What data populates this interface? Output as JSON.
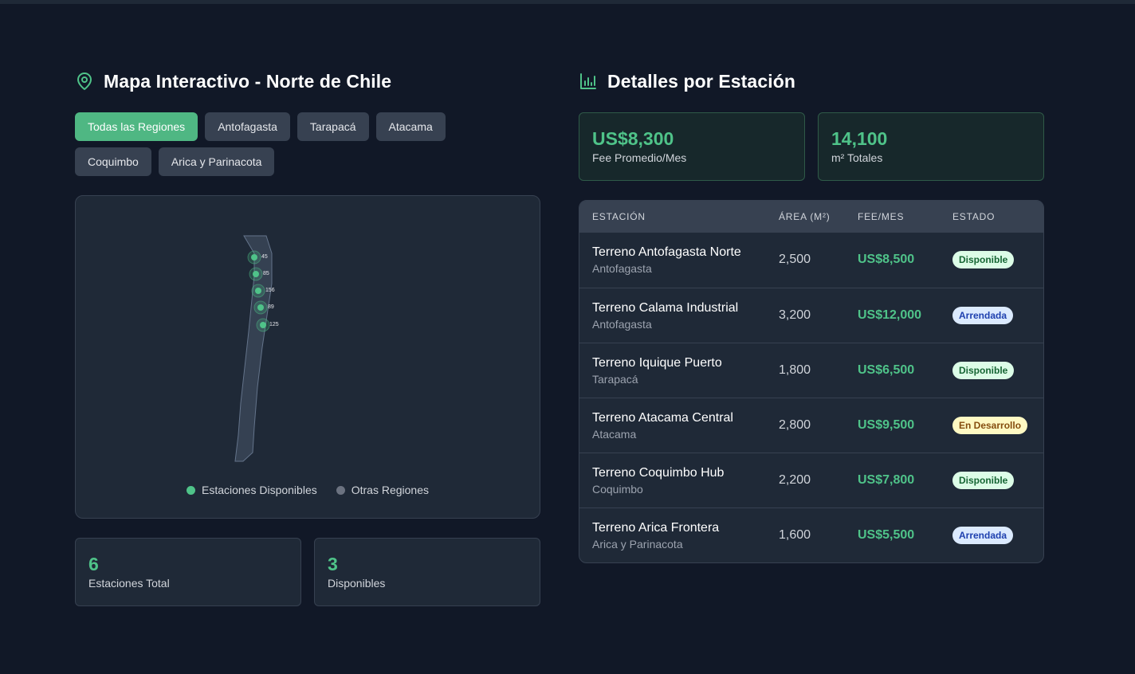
{
  "map_section": {
    "title": "Mapa Interactivo - Norte de Chile",
    "icon": "map-pin-icon",
    "filters": [
      {
        "label": "Todas las Regiones",
        "active": true
      },
      {
        "label": "Antofagasta",
        "active": false
      },
      {
        "label": "Tarapacá",
        "active": false
      },
      {
        "label": "Atacama",
        "active": false
      },
      {
        "label": "Coquimbo",
        "active": false
      },
      {
        "label": "Arica y Parinacota",
        "active": false
      }
    ],
    "map": {
      "markers": [
        {
          "label": "45"
        },
        {
          "label": "85"
        },
        {
          "label": "156"
        },
        {
          "label": "89"
        },
        {
          "label": "125"
        }
      ],
      "legend": [
        {
          "label": "Estaciones Disponibles",
          "color": "#4fc389"
        },
        {
          "label": "Otras Regiones",
          "color": "#6b7280"
        }
      ]
    },
    "stats": [
      {
        "value": "6",
        "label": "Estaciones Total"
      },
      {
        "value": "3",
        "label": "Disponibles"
      }
    ]
  },
  "details_section": {
    "title": "Detalles por Estación",
    "icon": "bar-chart-icon",
    "kpis": [
      {
        "value": "US$8,300",
        "label": "Fee Promedio/Mes"
      },
      {
        "value": "14,100",
        "label": "m² Totales"
      }
    ],
    "table": {
      "headers": [
        "Estación",
        "Área (m²)",
        "Fee/Mes",
        "Estado"
      ],
      "rows": [
        {
          "name": "Terreno Antofagasta Norte",
          "region": "Antofagasta",
          "area": "2,500",
          "fee": "US$8,500",
          "status": "Disponible"
        },
        {
          "name": "Terreno Calama Industrial",
          "region": "Antofagasta",
          "area": "3,200",
          "fee": "US$12,000",
          "status": "Arrendada"
        },
        {
          "name": "Terreno Iquique Puerto",
          "region": "Tarapacá",
          "area": "1,800",
          "fee": "US$6,500",
          "status": "Disponible"
        },
        {
          "name": "Terreno Atacama Central",
          "region": "Atacama",
          "area": "2,800",
          "fee": "US$9,500",
          "status": "En Desarrollo"
        },
        {
          "name": "Terreno Coquimbo Hub",
          "region": "Coquimbo",
          "area": "2,200",
          "fee": "US$7,800",
          "status": "Disponible"
        },
        {
          "name": "Terreno Arica Frontera",
          "region": "Arica y Parinacota",
          "area": "1,600",
          "fee": "US$5,500",
          "status": "Arrendada"
        }
      ]
    }
  },
  "colors": {
    "background": "#111827",
    "card": "#1f2937",
    "accent": "#4fc389",
    "accent_button": "#4fb783"
  }
}
